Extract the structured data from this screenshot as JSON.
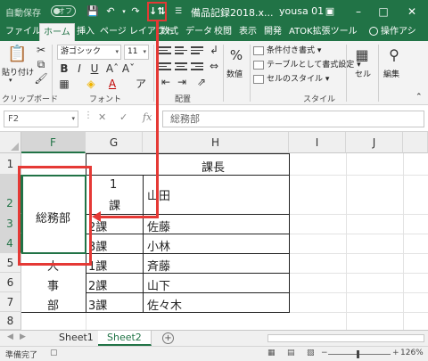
{
  "titlebar": {
    "autosave_label": "自動保存",
    "autosave_state": "オフ",
    "doc_title": "備品記録2018.x...",
    "user": "yousa 01",
    "sort_icon": "sort-ascending-icon",
    "accent": "#217346",
    "highlight": "#e53935"
  },
  "tabs": [
    {
      "label": "ファイル"
    },
    {
      "label": "ホーム"
    },
    {
      "label": "挿入"
    },
    {
      "label": "ページ レイアウト"
    },
    {
      "label": "数式"
    },
    {
      "label": "データ"
    },
    {
      "label": "校閲"
    },
    {
      "label": "表示"
    },
    {
      "label": "開発"
    },
    {
      "label": "ATOK拡張ツール"
    },
    {
      "label": "操作アシ"
    }
  ],
  "ribbon": {
    "paste_label": "貼り付け",
    "clipboard_label": "クリップボード",
    "font_name": "游ゴシック",
    "font_size": "11",
    "font_group_label": "フォント",
    "align_group_label": "配置",
    "number_label": "数値",
    "cond_format": "条件付き書式",
    "table_format": "テーブルとして書式設定",
    "cell_style": "セルのスタイル",
    "style_group_label": "スタイル",
    "cells_label": "セル",
    "edit_label": "編集"
  },
  "formula_bar": {
    "name_box": "F2",
    "value": "総務部"
  },
  "grid": {
    "columns": [
      "F",
      "G",
      "H",
      "I",
      "J"
    ],
    "rows": [
      "1",
      "2",
      "3",
      "4",
      "5",
      "6",
      "7",
      "8"
    ],
    "cells": {
      "h1": "課長",
      "g2a": "1",
      "g2b": "課",
      "h2": "山田",
      "f_merged": "総務部",
      "g3": "2課",
      "h3": "佐藤",
      "g4": "3課",
      "h4": "小林",
      "f5": "人",
      "g5": "1課",
      "h5": "斉藤",
      "f6": "事",
      "g6": "2課",
      "h6": "山下",
      "f7": "部",
      "g7": "3課",
      "h7": "佐々木"
    }
  },
  "sheets": [
    {
      "label": "Sheet1",
      "active": false
    },
    {
      "label": "Sheet2",
      "active": true
    }
  ],
  "status": {
    "text": "準備完了",
    "zoom": "126%"
  }
}
